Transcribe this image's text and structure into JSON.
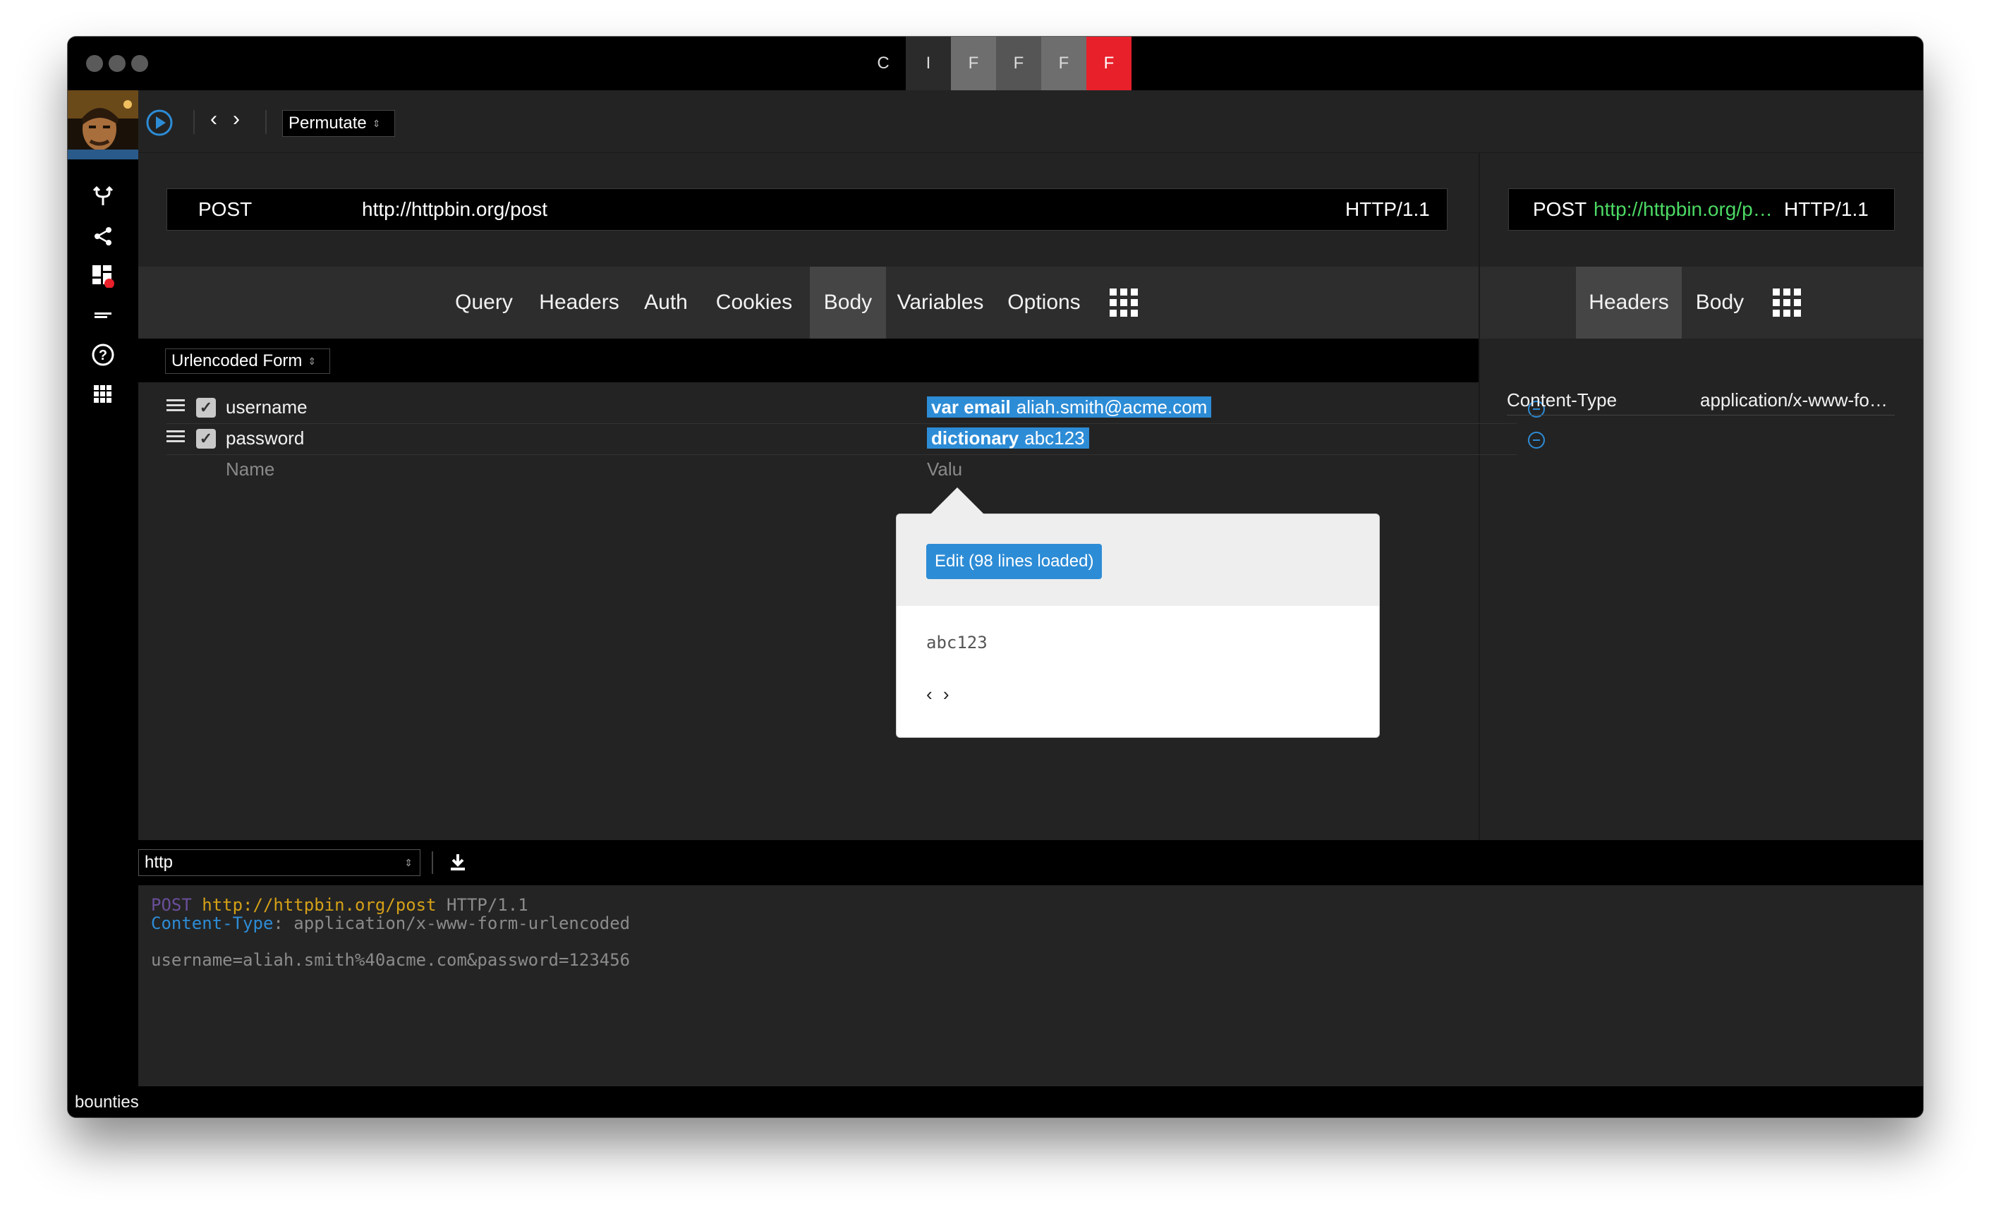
{
  "titlebar": {
    "buttons": [
      {
        "label": "C",
        "color": "#000000"
      },
      {
        "label": "I",
        "color": "#2b2b2b"
      },
      {
        "label": "F",
        "color": "#6e6e6e"
      },
      {
        "label": "F",
        "color": "#555555"
      },
      {
        "label": "F",
        "color": "#6e6e6e"
      },
      {
        "label": "F",
        "color": "#e8202a"
      }
    ]
  },
  "toolbar": {
    "mode_select": "Permutate"
  },
  "request": {
    "method": "POST",
    "url": "http://httpbin.org/post",
    "protocol": "HTTP/1.1"
  },
  "response_summary": {
    "method": "POST",
    "url": "http://httpbin.org/p…",
    "protocol": "HTTP/1.1"
  },
  "tabs": [
    "Query",
    "Headers",
    "Auth",
    "Cookies",
    "Body",
    "Variables",
    "Options"
  ],
  "active_tab": "Body",
  "response_tabs": [
    "Headers",
    "Body"
  ],
  "body": {
    "format_select": "Urlencoded Form",
    "rows": [
      {
        "name": "username",
        "token_kind": "var email",
        "token_value": "aliah.smith@acme.com",
        "checked": true
      },
      {
        "name": "password",
        "token_kind": "dictionary",
        "token_value": "abc123",
        "checked": true
      }
    ],
    "name_placeholder": "Name",
    "value_placeholder": "Valu"
  },
  "popover": {
    "edit_button": "Edit (98 lines loaded)",
    "current_value": "abc123",
    "nav": "‹ ›"
  },
  "response_headers": [
    {
      "name": "Content-Type",
      "value": "application/x-www-fo…"
    }
  ],
  "output": {
    "format_select": "http",
    "line1_method": "POST",
    "line1_url": "http://httpbin.org/post",
    "line1_proto": "HTTP/1.1",
    "line2_key": "Content-Type",
    "line2_value": ": application/x-www-form-urlencoded",
    "line4": "username=aliah.smith%40acme.com&password=123456"
  },
  "status": {
    "label": "bounties"
  },
  "colors": {
    "accent": "#2d8cd6",
    "alert": "#e8202a"
  }
}
